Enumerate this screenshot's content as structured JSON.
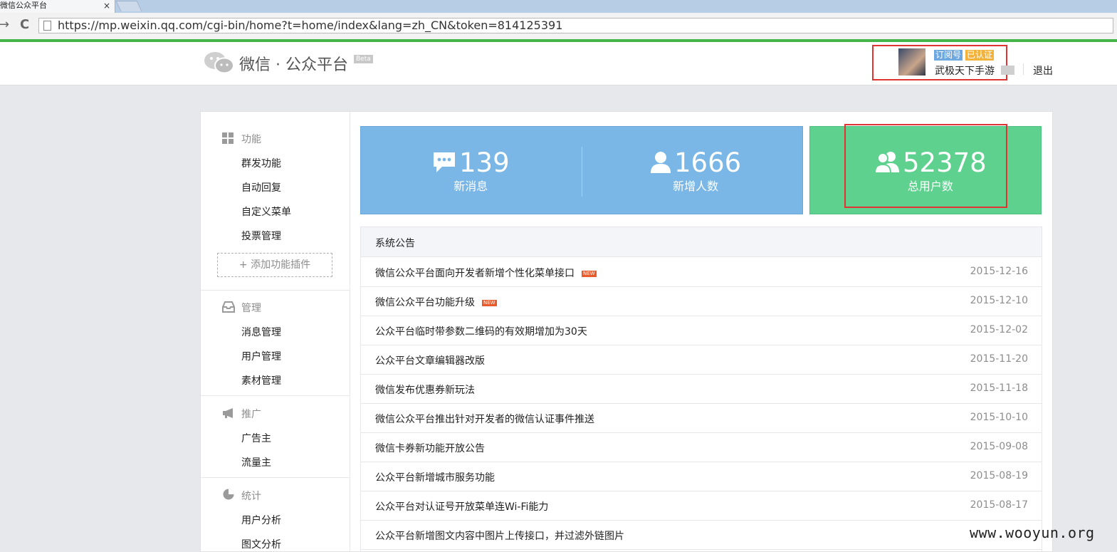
{
  "browser": {
    "tab_title": "微信公众平台",
    "tab_close": "×",
    "back": "→",
    "reload": "C",
    "url": "https://mp.weixin.qq.com/cgi-bin/home?t=home/index&lang=zh_CN&token=814125391"
  },
  "header": {
    "logo_text": "微信 · 公众平台",
    "beta": "Beta",
    "badge_subscription": "订阅号",
    "badge_verified": "已认证",
    "account_name": "武极天下手游",
    "logout": "退出"
  },
  "sidebar": {
    "sections": [
      {
        "title": "功能",
        "items": [
          "群发功能",
          "自动回复",
          "自定义菜单",
          "投票管理"
        ]
      },
      {
        "title": "管理",
        "items": [
          "消息管理",
          "用户管理",
          "素材管理"
        ]
      },
      {
        "title": "推广",
        "items": [
          "广告主",
          "流量主"
        ]
      },
      {
        "title": "统计",
        "items": [
          "用户分析",
          "图文分析"
        ]
      }
    ],
    "add_plugin": "+ 添加功能插件"
  },
  "stats": {
    "new_messages": {
      "value": "139",
      "label": "新消息"
    },
    "new_followers": {
      "value": "1666",
      "label": "新增人数"
    },
    "total_users": {
      "value": "52378",
      "label": "总用户数"
    }
  },
  "notices": {
    "title": "系统公告",
    "new_badge": "NEW",
    "items": [
      {
        "title": "微信公众平台面向开发者新增个性化菜单接口",
        "date": "2015-12-16",
        "is_new": true
      },
      {
        "title": "微信公众平台功能升级",
        "date": "2015-12-10",
        "is_new": true
      },
      {
        "title": "公众平台临时带参数二维码的有效期增加为30天",
        "date": "2015-12-02",
        "is_new": false
      },
      {
        "title": "公众平台文章编辑器改版",
        "date": "2015-11-20",
        "is_new": false
      },
      {
        "title": "微信发布优惠券新玩法",
        "date": "2015-11-18",
        "is_new": false
      },
      {
        "title": "微信公众平台推出针对开发者的微信认证事件推送",
        "date": "2015-10-10",
        "is_new": false
      },
      {
        "title": "微信卡券新功能开放公告",
        "date": "2015-09-08",
        "is_new": false
      },
      {
        "title": "公众平台新增城市服务功能",
        "date": "2015-08-19",
        "is_new": false
      },
      {
        "title": "公众平台对认证号开放菜单连Wi-Fi能力",
        "date": "2015-08-17",
        "is_new": false
      },
      {
        "title": "公众平台新增图文内容中图片上传接口，并过滤外链图片",
        "date": "",
        "is_new": false
      }
    ]
  },
  "watermark": "www.wooyun.org",
  "colors": {
    "brand_green": "#44b549",
    "stat_blue": "#7ab7e6",
    "stat_green": "#5ed18f",
    "highlight_red": "#e03333"
  }
}
